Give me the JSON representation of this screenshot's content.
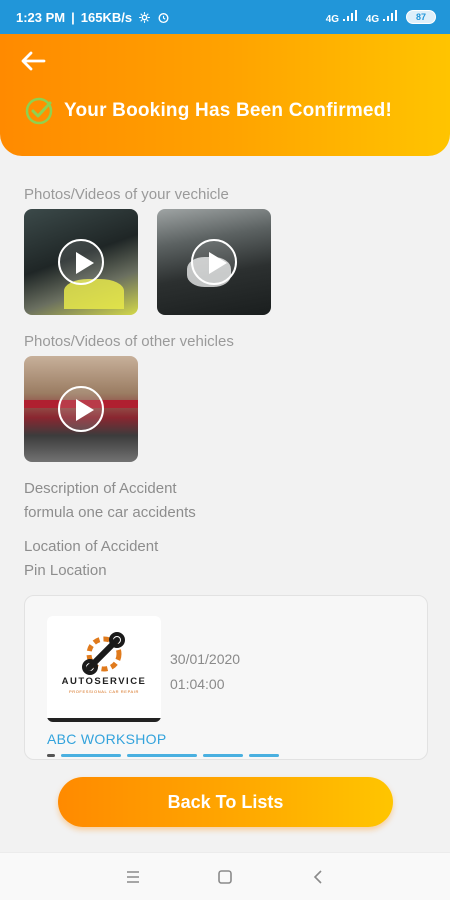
{
  "status_bar": {
    "time": "1:23 PM",
    "net_speed": "165KB/s",
    "sim1": "4G",
    "sim2": "4G",
    "battery": "87"
  },
  "header": {
    "title": "Your Booking Has Been Confirmed!",
    "back_icon": "arrow-left-icon",
    "check_icon": "check-circle-icon"
  },
  "sections": {
    "your_vehicle_label": "Photos/Videos of your vechicle",
    "other_vehicles_label": "Photos/Videos of other vehicles",
    "description_label": "Description of Accident",
    "description_value": "formula one car accidents",
    "location_label": "Location of Accident",
    "location_value": "Pin Location"
  },
  "workshop_card": {
    "logo_title": "AUTOSERVICE",
    "logo_subtitle": "PROFESSIONAL CAR REPAIR",
    "date": "30/01/2020",
    "time": "01:04:00",
    "name": "ABC WORKSHOP"
  },
  "cta": {
    "label": "Back To Lists"
  },
  "colors": {
    "accent_orange": "#ff8a00",
    "accent_yellow": "#ffc400",
    "status_blue": "#2196d9",
    "link_blue": "#33a3dc"
  }
}
